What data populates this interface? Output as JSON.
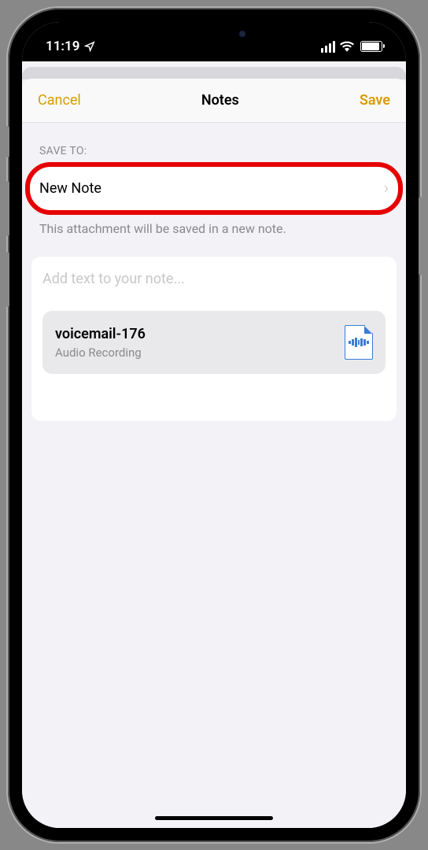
{
  "status": {
    "time": "11:19"
  },
  "nav": {
    "cancel": "Cancel",
    "title": "Notes",
    "save": "Save"
  },
  "section": {
    "saveToLabel": "SAVE TO:",
    "destination": "New Note",
    "hint": "This attachment will be saved in a new note."
  },
  "note": {
    "placeholder": "Add text to your note...",
    "attachment": {
      "title": "voicemail-176",
      "subtitle": "Audio Recording"
    }
  }
}
